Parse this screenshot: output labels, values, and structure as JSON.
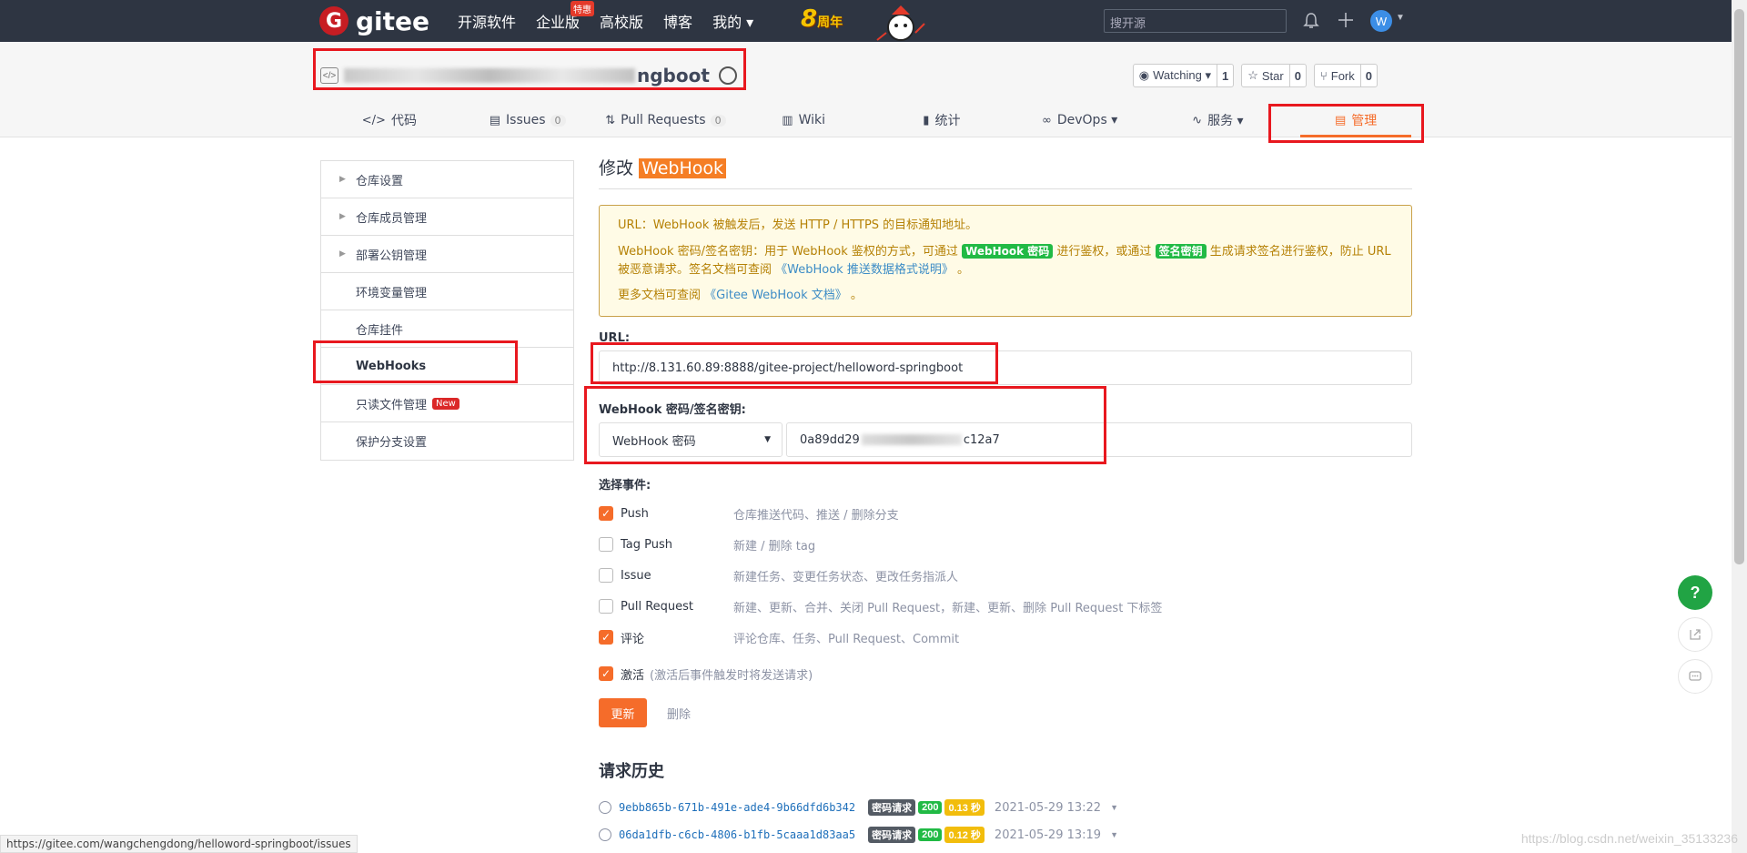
{
  "topbar": {
    "logo_letter": "G",
    "logo_text": "gitee",
    "nav": [
      "开源软件",
      "企业版",
      "高校版",
      "博客",
      "我的 ▾"
    ],
    "hot_badge": "特惠",
    "anniversary": {
      "num": "8",
      "text": "周年"
    },
    "search_placeholder": "搜开源",
    "bell_icon": "bell-icon",
    "plus_icon": "plus-icon",
    "avatar_letter": "W"
  },
  "repo": {
    "name_suffix": "ngboot",
    "watch": {
      "label": "Watching ▾",
      "count": "1"
    },
    "star": {
      "label": "Star",
      "count": "0"
    },
    "fork": {
      "label": "Fork",
      "count": "0"
    }
  },
  "tabs": [
    {
      "icon": "</>",
      "label": "代码",
      "count": ""
    },
    {
      "icon": "▤",
      "label": "Issues",
      "count": "0"
    },
    {
      "icon": "⇅",
      "label": "Pull Requests",
      "count": "0"
    },
    {
      "icon": "▥",
      "label": "Wiki",
      "count": ""
    },
    {
      "icon": "▮",
      "label": "统计",
      "count": ""
    },
    {
      "icon": "∞",
      "label": "DevOps ▾",
      "count": ""
    },
    {
      "icon": "∿",
      "label": "服务 ▾",
      "count": ""
    },
    {
      "icon": "▤",
      "label": "管理",
      "count": ""
    }
  ],
  "sidebar": {
    "items": [
      {
        "label": "仓库设置",
        "arrow": true
      },
      {
        "label": "仓库成员管理",
        "arrow": true
      },
      {
        "label": "部署公钥管理",
        "arrow": true
      },
      {
        "label": "环境变量管理",
        "arrow": false
      },
      {
        "label": "仓库挂件",
        "arrow": false
      },
      {
        "label": "WebHooks",
        "arrow": false
      },
      {
        "label": "只读文件管理",
        "arrow": false,
        "badge": "New"
      },
      {
        "label": "保护分支设置",
        "arrow": false
      }
    ]
  },
  "main": {
    "title_prefix": "修改",
    "title_hl": "WebHook",
    "info": {
      "line1": "URL：WebHook 被触发后，发送 HTTP / HTTPS 的目标通知地址。",
      "line2a": "WebHook 密码/签名密钥：用于 WebHook 鉴权的方式，可通过",
      "tag1": "WebHook 密码",
      "line2b": "进行鉴权，或通过",
      "tag2": "签名密钥",
      "line2c": "生成请求签名进行鉴权，防止 URL 被恶意请求。签名文档可查阅",
      "link1": "《WebHook 推送数据格式说明》",
      "line2d": "。",
      "line3a": "更多文档可查阅",
      "link2": "《Gitee WebHook 文档》",
      "line3b": "。"
    },
    "url_label": "URL:",
    "url_value": "http://8.131.60.89:8888/gitee-project/helloword-springboot",
    "secret_label": "WebHook 密码/签名密钥:",
    "secret_type": "WebHook 密码",
    "secret_start": "0a89dd29",
    "secret_end": "c12a7",
    "events_label": "选择事件:",
    "events": [
      {
        "name": "Push",
        "desc": "仓库推送代码、推送 / 删除分支",
        "checked": true
      },
      {
        "name": "Tag Push",
        "desc": "新建 / 删除 tag",
        "checked": false
      },
      {
        "name": "Issue",
        "desc": "新建任务、变更任务状态、更改任务指派人",
        "checked": false
      },
      {
        "name": "Pull Request",
        "desc": "新建、更新、合并、关闭 Pull Request，新建、更新、删除 Pull Request 下标签",
        "checked": false
      },
      {
        "name": "评论",
        "desc": "评论仓库、任务、Pull Request、Commit",
        "checked": true
      }
    ],
    "active": {
      "name": "激活",
      "hint": "(激活后事件触发时将发送请求)",
      "checked": true
    },
    "update_btn": "更新",
    "delete_btn": "删除",
    "history_title": "请求历史",
    "history": [
      {
        "id": "9ebb865b-671b-491e-ade4-9b66dfd6b342",
        "type": "密码请求",
        "code": "200",
        "time": "0.13 秒",
        "date": "2021-05-29 13:22"
      },
      {
        "id": "06da1dfb-c6cb-4806-b1fb-5caaa1d83aa5",
        "type": "密码请求",
        "code": "200",
        "time": "0.12 秒",
        "date": "2021-05-29 13:19"
      }
    ]
  },
  "statusbar": "https://gitee.com/wangchengdong/helloword-springboot/issues",
  "watermark": "https://blog.csdn.net/weixin_35133236",
  "fab": {
    "help": "?"
  }
}
